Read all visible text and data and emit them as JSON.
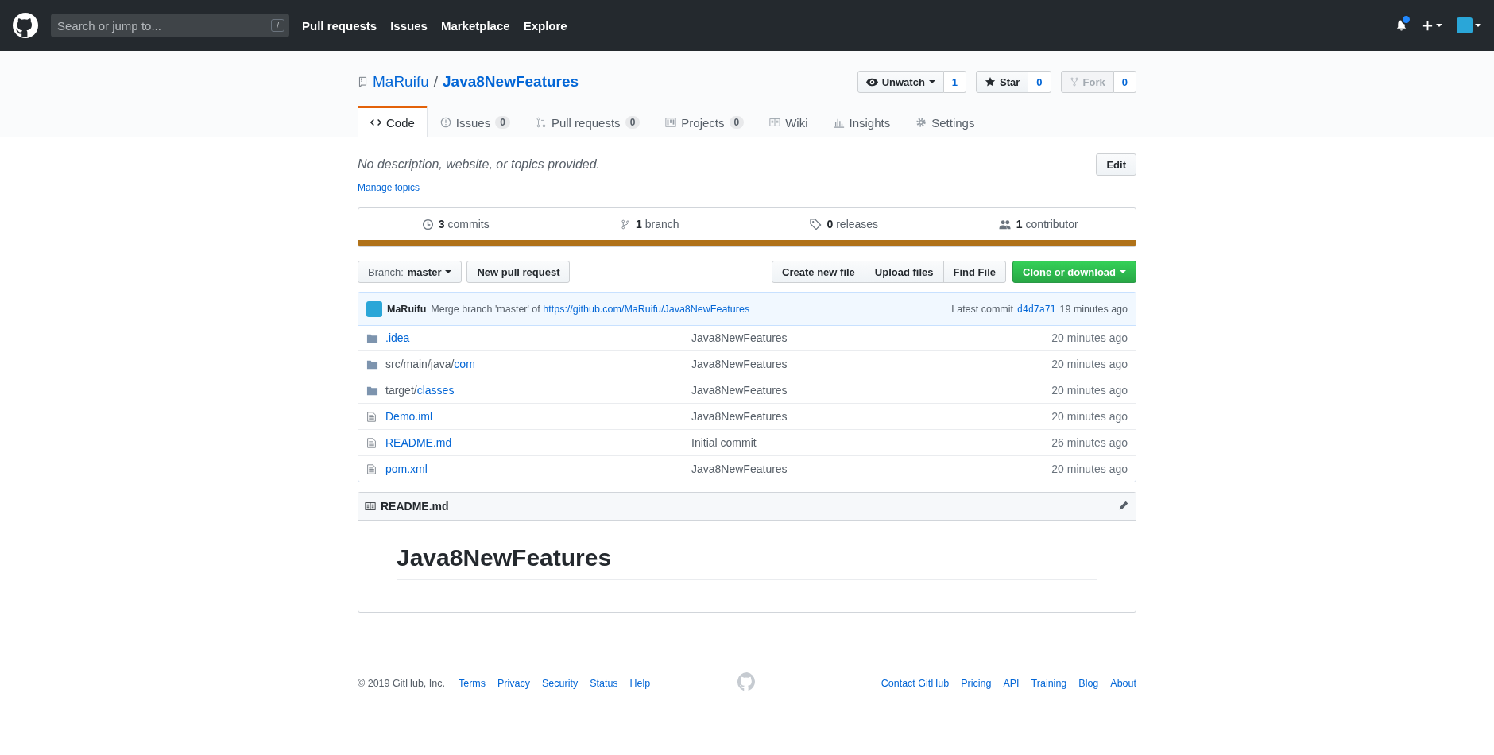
{
  "header": {
    "search": {
      "placeholder": "Search or jump to...",
      "key_hint": "/"
    },
    "nav": [
      "Pull requests",
      "Issues",
      "Marketplace",
      "Explore"
    ],
    "notifications": {
      "unread": true
    }
  },
  "repo": {
    "owner": "MaRuifu",
    "separator": "/",
    "name": "Java8NewFeatures",
    "actions": [
      {
        "label": "Unwatch",
        "count": "1",
        "dropdown": true,
        "disabled": false,
        "kind": "eye"
      },
      {
        "label": "Star",
        "count": "0",
        "dropdown": false,
        "disabled": false,
        "kind": "star"
      },
      {
        "label": "Fork",
        "count": "0",
        "dropdown": false,
        "disabled": true,
        "kind": "fork"
      }
    ],
    "tabs": [
      {
        "label": "Code",
        "selected": true,
        "kind": "code"
      },
      {
        "label": "Issues",
        "counter": "0",
        "selected": false,
        "kind": "issue"
      },
      {
        "label": "Pull requests",
        "counter": "0",
        "selected": false,
        "kind": "pr"
      },
      {
        "label": "Projects",
        "counter": "0",
        "selected": false,
        "kind": "project"
      },
      {
        "label": "Wiki",
        "selected": false,
        "kind": "wiki"
      },
      {
        "label": "Insights",
        "selected": false,
        "kind": "insights"
      },
      {
        "label": "Settings",
        "selected": false,
        "kind": "settings"
      }
    ]
  },
  "description": {
    "text": "No description, website, or topics provided.",
    "edit_button": "Edit",
    "manage_topics": "Manage topics"
  },
  "summary": [
    {
      "count": "3",
      "label": "commits",
      "kind": "history"
    },
    {
      "count": "1",
      "label": "branch",
      "kind": "branch"
    },
    {
      "count": "0",
      "label": "releases",
      "kind": "tag"
    },
    {
      "count": "1",
      "label": "contributor",
      "kind": "people"
    }
  ],
  "toolbar": {
    "branch_label": "Branch:",
    "branch": "master",
    "new_pr": "New pull request",
    "file_buttons": [
      "Create new file",
      "Upload files",
      "Find File"
    ],
    "clone": "Clone or download"
  },
  "latest_commit": {
    "author": "MaRuifu",
    "message": "Merge branch 'master' of",
    "link": "https://github.com/MaRuifu/Java8NewFeatures",
    "label": "Latest commit",
    "sha": "d4d7a71",
    "age": "19 minutes ago"
  },
  "files": [
    {
      "kind": "dir",
      "name": ".idea",
      "message": "Java8NewFeatures",
      "age": "20 minutes ago"
    },
    {
      "kind": "dir",
      "prefix": "src/main/java/",
      "name": "com",
      "message": "Java8NewFeatures",
      "age": "20 minutes ago"
    },
    {
      "kind": "dir",
      "prefix": "target/",
      "name": "classes",
      "message": "Java8NewFeatures",
      "age": "20 minutes ago"
    },
    {
      "kind": "file",
      "name": "Demo.iml",
      "message": "Java8NewFeatures",
      "age": "20 minutes ago"
    },
    {
      "kind": "file",
      "name": "README.md",
      "message": "Initial commit",
      "age": "26 minutes ago"
    },
    {
      "kind": "file",
      "name": "pom.xml",
      "message": "Java8NewFeatures",
      "age": "20 minutes ago"
    }
  ],
  "readme": {
    "filename": "README.md",
    "heading": "Java8NewFeatures"
  },
  "footer": {
    "copyright": "© 2019 GitHub, Inc.",
    "left_links": [
      "Terms",
      "Privacy",
      "Security",
      "Status",
      "Help"
    ],
    "right_links": [
      "Contact GitHub",
      "Pricing",
      "API",
      "Training",
      "Blog",
      "About"
    ]
  }
}
